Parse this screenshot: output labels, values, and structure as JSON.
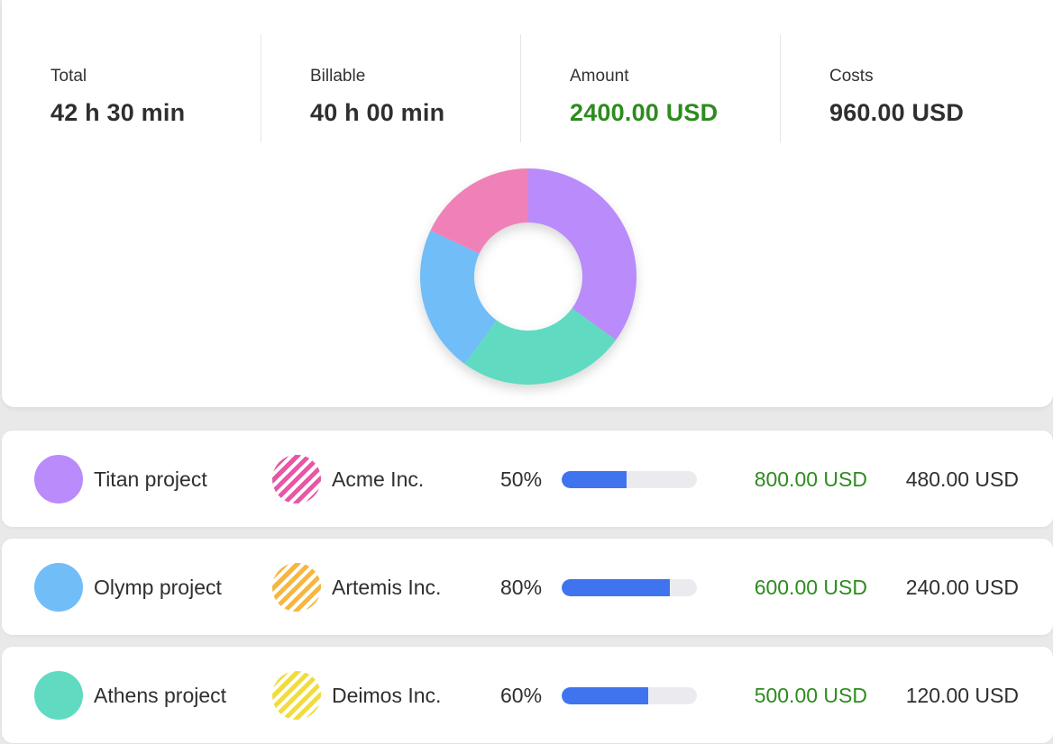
{
  "summary": {
    "stats": [
      {
        "label": "Total",
        "value": "42 h 30 min"
      },
      {
        "label": "Billable",
        "value": "40 h 00 min"
      },
      {
        "label": "Amount",
        "value": "2400.00 USD",
        "color": "#2e8b1f"
      },
      {
        "label": "Costs",
        "value": "960.00 USD"
      }
    ]
  },
  "donut": {
    "segments": [
      {
        "color": "#b98bfb",
        "fraction": 0.35
      },
      {
        "color": "#60dbc1",
        "fraction": 0.25
      },
      {
        "color": "#70bdf8",
        "fraction": 0.22
      },
      {
        "color": "#f081b8",
        "fraction": 0.18
      }
    ]
  },
  "rows": [
    {
      "project": "Titan project",
      "project_color": "#b98bfb",
      "client": "Acme Inc.",
      "client_color": "#e757a6",
      "percent_label": "50%",
      "progress": 0.48,
      "amount": "800.00 USD",
      "cost": "480.00 USD"
    },
    {
      "project": "Olymp project",
      "project_color": "#70bdf8",
      "client": "Artemis Inc.",
      "client_color": "#f7b640",
      "percent_label": "80%",
      "progress": 0.8,
      "amount": "600.00 USD",
      "cost": "240.00 USD"
    },
    {
      "project": "Athens project",
      "project_color": "#60dbc1",
      "client": "Deimos Inc.",
      "client_color": "#f2dc3c",
      "percent_label": "60%",
      "progress": 0.64,
      "amount": "500.00 USD",
      "cost": "120.00 USD"
    }
  ],
  "colors": {
    "amount_green": "#2e8b1f",
    "progress_blue": "#3f74ee",
    "progress_track": "#ebebef"
  }
}
